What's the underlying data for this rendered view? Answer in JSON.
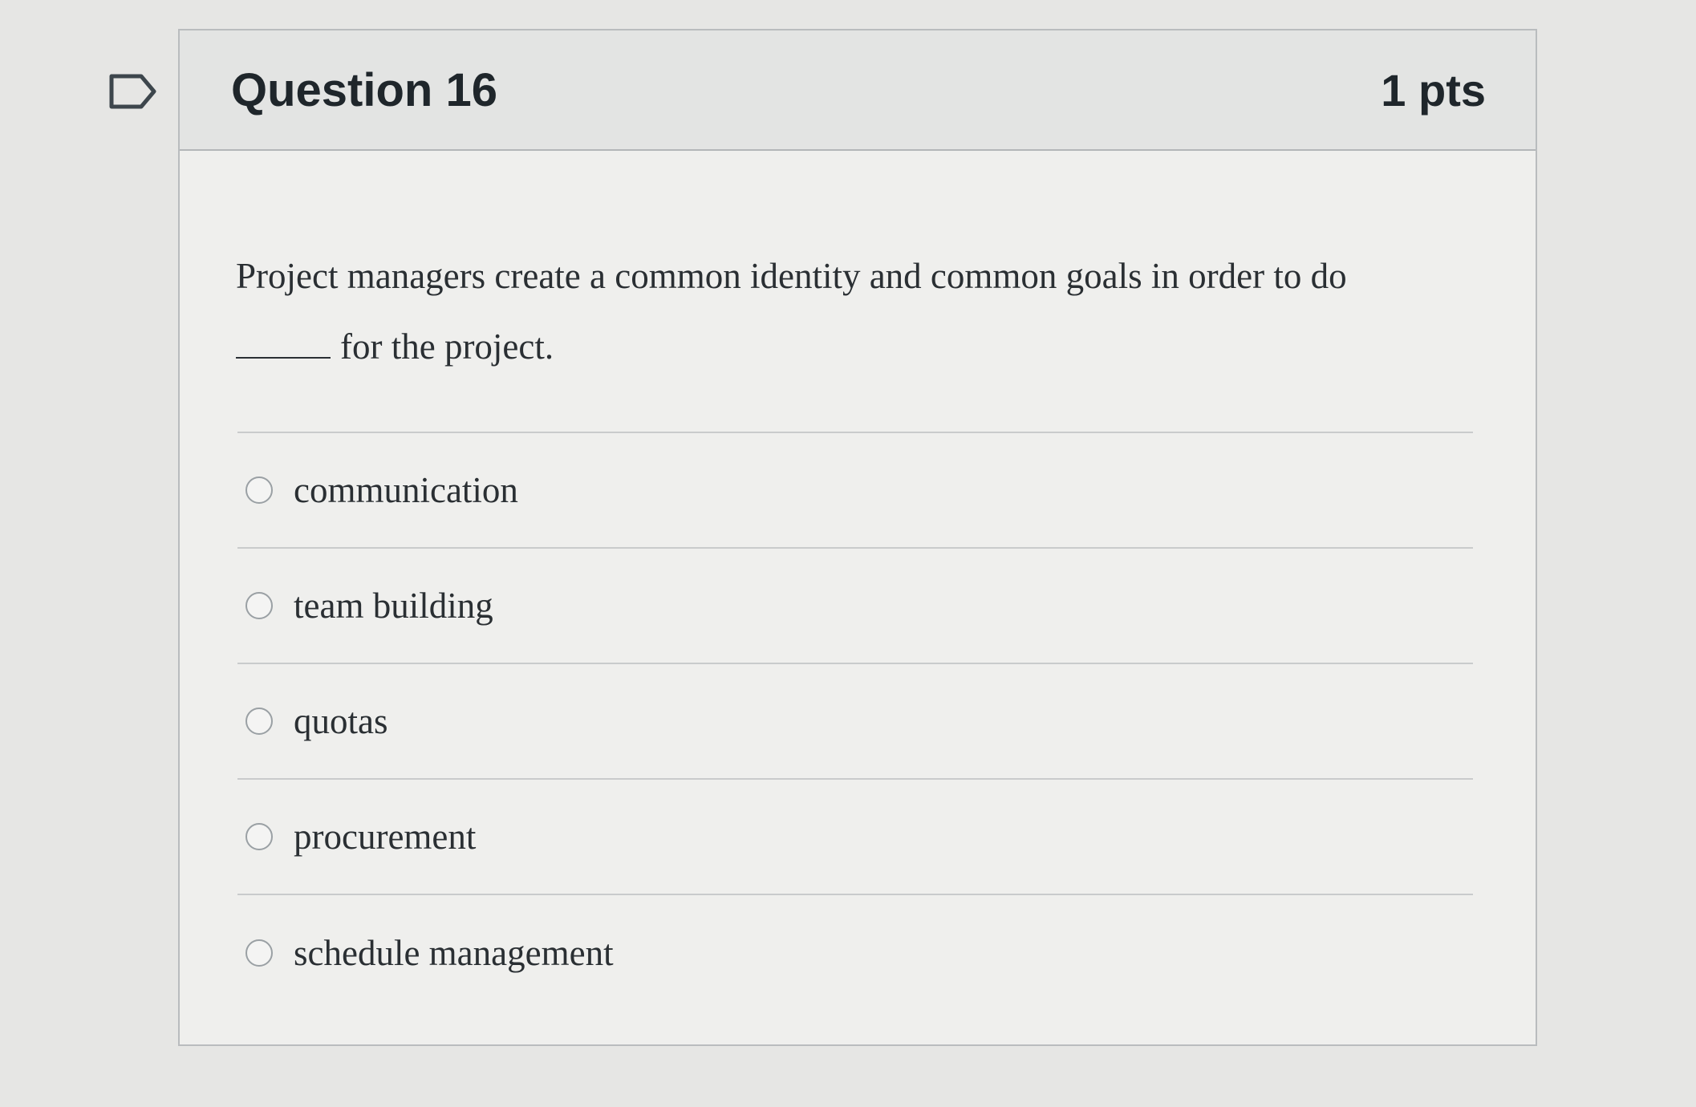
{
  "question": {
    "title": "Question 16",
    "points": "1 pts",
    "text_line1": "Project managers create a common identity and common goals in order to do",
    "text_line2": "for the project."
  },
  "answers": [
    {
      "label": "communication",
      "selected": false
    },
    {
      "label": "team building",
      "selected": false
    },
    {
      "label": "quotas",
      "selected": false
    },
    {
      "label": "procurement",
      "selected": false
    },
    {
      "label": "schedule management",
      "selected": false
    }
  ],
  "icons": {
    "flag": "bookmark-flag-icon"
  }
}
